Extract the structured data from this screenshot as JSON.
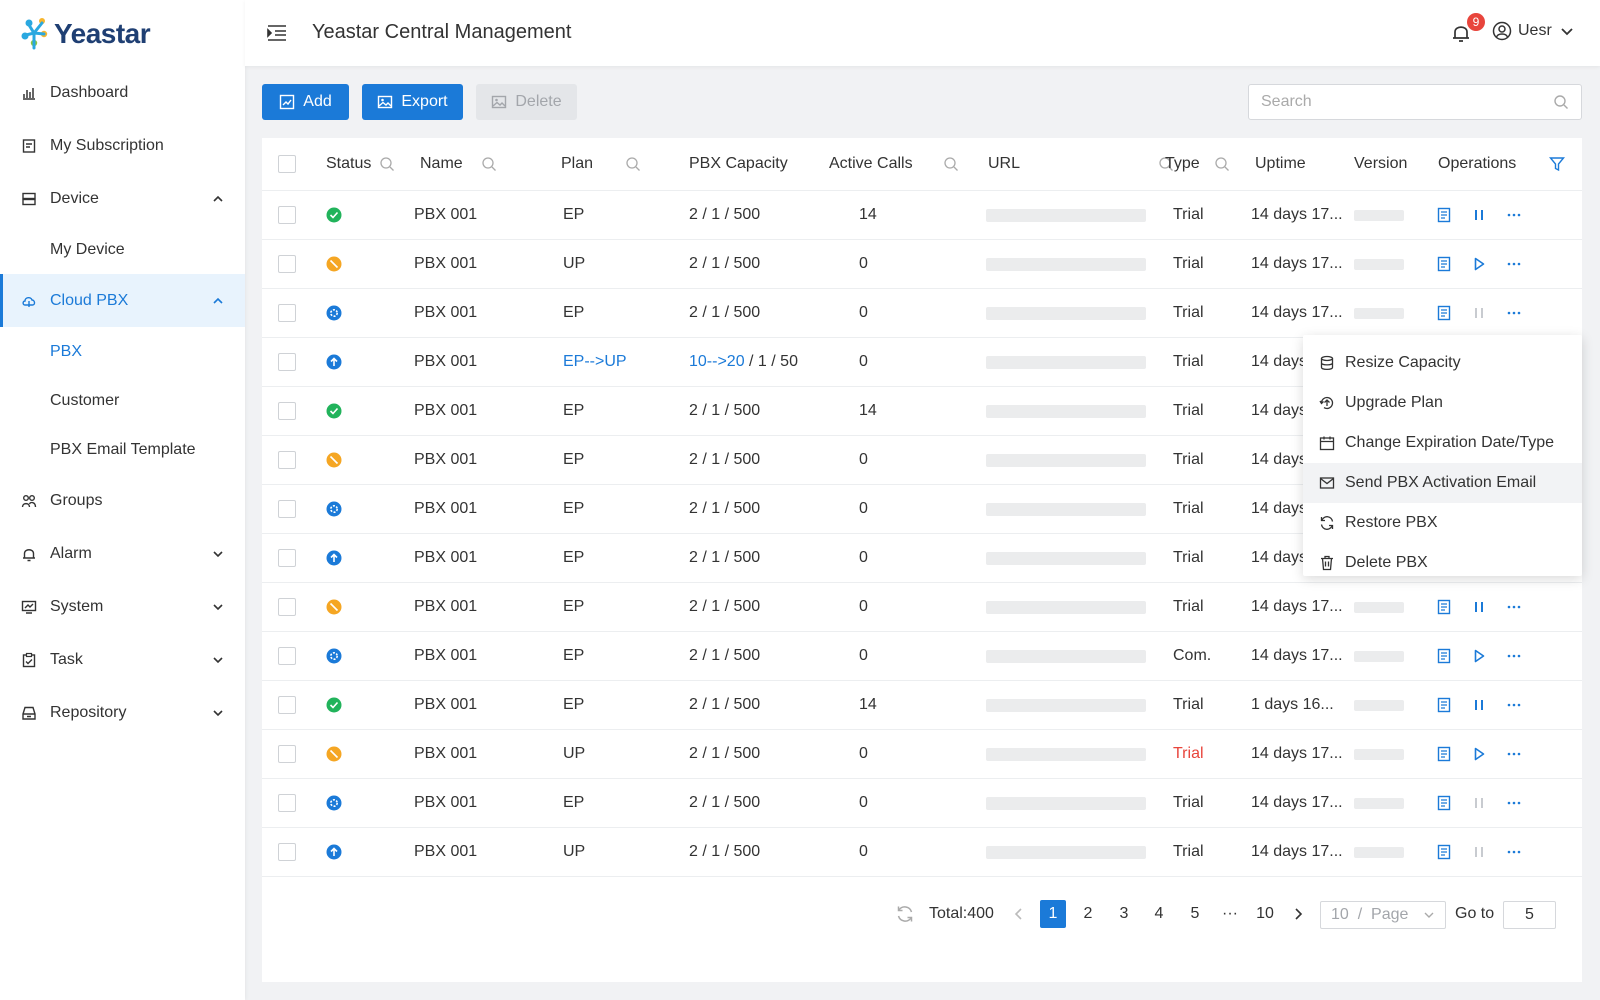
{
  "brand": {
    "logo_text": "Yeastar",
    "colors": {
      "primary": "#1b7ad8",
      "green": "#21b35b",
      "orange": "#f5a623",
      "danger": "#e8453c"
    }
  },
  "sidebar": {
    "items": [
      {
        "label": "Dashboard",
        "icon": "dashboard-icon"
      },
      {
        "label": "My Subscription",
        "icon": "subscription-icon"
      },
      {
        "label": "Device",
        "icon": "device-icon",
        "expanded": true
      },
      {
        "label": "My Device"
      },
      {
        "label": "Cloud PBX",
        "icon": "cloud-icon",
        "expanded": true,
        "active": true
      },
      {
        "label": "PBX",
        "active": true
      },
      {
        "label": "Customer"
      },
      {
        "label": "PBX Email Template"
      },
      {
        "label": "Groups",
        "icon": "groups-icon"
      },
      {
        "label": "Alarm",
        "icon": "bell-icon"
      },
      {
        "label": "System",
        "icon": "system-icon"
      },
      {
        "label": "Task",
        "icon": "task-icon"
      },
      {
        "label": "Repository",
        "icon": "repository-icon"
      }
    ]
  },
  "header": {
    "title": "Yeastar Central Management",
    "notification_count": "9",
    "user": "Uesr"
  },
  "toolbar": {
    "add": "Add",
    "export": "Export",
    "delete": "Delete",
    "search_placeholder": "Search"
  },
  "table": {
    "columns": {
      "status": "Status",
      "name": "Name",
      "plan": "Plan",
      "capacity": "PBX Capacity",
      "calls": "Active Calls",
      "url": "URL",
      "type": "Type",
      "uptime": "Uptime",
      "version": "Version",
      "operations": "Operations"
    },
    "rows": [
      {
        "status": "online",
        "name": "PBX 001",
        "plan": "EP",
        "cap_a": "2",
        "cap_rest": " / 1 / 500",
        "calls": "14",
        "type": "Trial",
        "uptime": "14 days 17...",
        "action": "pause",
        "enabled": true
      },
      {
        "status": "offline",
        "name": "PBX 001",
        "plan": "UP",
        "cap_a": "2",
        "cap_rest": " / 1 / 500",
        "calls": "0",
        "type": "Trial",
        "uptime": "14 days 17...",
        "action": "play",
        "enabled": true
      },
      {
        "status": "processing",
        "name": "PBX 001",
        "plan": "EP",
        "cap_a": "2",
        "cap_rest": " / 1 / 500",
        "calls": "0",
        "type": "Trial",
        "uptime": "14 days 17...",
        "action": "pause",
        "enabled": false
      },
      {
        "status": "upgrading",
        "name": "PBX 001",
        "plan": "EP-->UP",
        "plan_link": true,
        "cap_a": "10-->20",
        "cap_link": true,
        "cap_rest": " / 1 / 50",
        "calls": "0",
        "type": "Trial",
        "uptime": "14 days",
        "action": "",
        "enabled": true
      },
      {
        "status": "online",
        "name": "PBX 001",
        "plan": "EP",
        "cap_a": "2",
        "cap_rest": " / 1 / 500",
        "calls": "14",
        "type": "Trial",
        "uptime": "14 days",
        "action": "",
        "enabled": true
      },
      {
        "status": "offline",
        "name": "PBX 001",
        "plan": "EP",
        "cap_a": "2",
        "cap_rest": " / 1 / 500",
        "calls": "0",
        "type": "Trial",
        "uptime": "14 days",
        "action": "",
        "enabled": true
      },
      {
        "status": "processing",
        "name": "PBX 001",
        "plan": "EP",
        "cap_a": "2",
        "cap_rest": " / 1 / 500",
        "calls": "0",
        "type": "Trial",
        "uptime": "14 days",
        "action": "",
        "enabled": true
      },
      {
        "status": "upgrading",
        "name": "PBX 001",
        "plan": "EP",
        "cap_a": "2",
        "cap_rest": " / 1 / 500",
        "calls": "0",
        "type": "Trial",
        "uptime": "14 days",
        "action": "",
        "enabled": true
      },
      {
        "status": "offline",
        "name": "PBX 001",
        "plan": "EP",
        "cap_a": "2",
        "cap_rest": " / 1 / 500",
        "calls": "0",
        "type": "Trial",
        "uptime": "14 days 17...",
        "action": "pause",
        "enabled": true
      },
      {
        "status": "processing",
        "name": "PBX 001",
        "plan": "EP",
        "cap_a": "2",
        "cap_rest": " / 1 / 500",
        "calls": "0",
        "type": "Com.",
        "uptime": "14 days 17...",
        "action": "play",
        "enabled": true
      },
      {
        "status": "online",
        "name": "PBX 001",
        "plan": "EP",
        "cap_a": "2",
        "cap_rest": " / 1 / 500",
        "calls": "14",
        "type": "Trial",
        "uptime": "1 days 16...",
        "action": "pause",
        "enabled": true
      },
      {
        "status": "offline",
        "name": "PBX 001",
        "plan": "UP",
        "cap_a": "2",
        "cap_rest": " / 1 / 500",
        "calls": "0",
        "type": "Trial",
        "type_warn": true,
        "uptime": "14 days 17...",
        "action": "play",
        "enabled": true
      },
      {
        "status": "processing",
        "name": "PBX 001",
        "plan": "EP",
        "cap_a": "2",
        "cap_rest": " / 1 / 500",
        "calls": "0",
        "type": "Trial",
        "uptime": "14 days 17...",
        "action": "pause",
        "enabled": false
      },
      {
        "status": "upgrading",
        "name": "PBX 001",
        "plan": "UP",
        "cap_a": "2",
        "cap_rest": " / 1 / 500",
        "calls": "0",
        "type": "Trial",
        "uptime": "14 days 17...",
        "action": "pause",
        "enabled": false
      }
    ]
  },
  "dropdown": {
    "items": [
      {
        "label": "Resize Capacity",
        "icon": "database-icon"
      },
      {
        "label": "Upgrade Plan",
        "icon": "upgrade-icon"
      },
      {
        "label": "Change Expiration Date/Type",
        "icon": "calendar-icon"
      },
      {
        "label": "Send PBX Activation Email",
        "icon": "mail-icon",
        "hover": true
      },
      {
        "label": "Restore PBX",
        "icon": "restore-icon"
      },
      {
        "label": "Delete PBX",
        "icon": "trash-icon"
      }
    ]
  },
  "pagination": {
    "total": "Total:400",
    "pages": [
      "1",
      "2",
      "3",
      "4",
      "5",
      "···",
      "10"
    ],
    "current": "1",
    "page_size": "10  /  Page",
    "goto_label": "Go to",
    "goto_value": "5"
  }
}
